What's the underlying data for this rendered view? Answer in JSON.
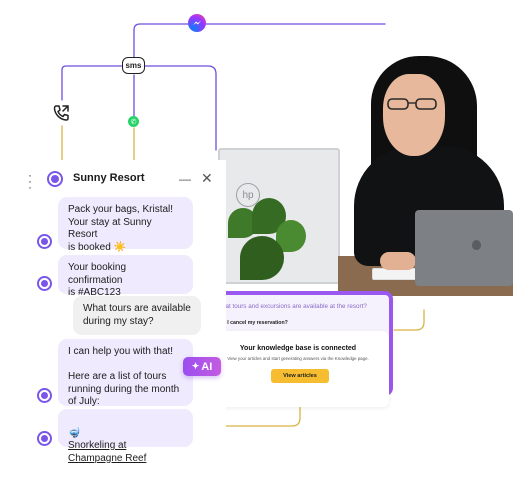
{
  "chat": {
    "brand_name": "Sunny Resort",
    "messages": [
      {
        "role": "bot",
        "text": "Pack your bags, Kristal!\nYour stay at Sunny Resort\nis booked ☀️"
      },
      {
        "role": "bot",
        "text": "Your booking confirmation\nis #ABC123"
      },
      {
        "role": "user",
        "text": "What tours are available\nduring my stay?"
      },
      {
        "role": "bot",
        "text": "I can help you with that!\n\nHere are a list of tours\nrunning during the month\nof July:"
      },
      {
        "role": "bot",
        "emoji": "🤿",
        "link_text": "Snorkeling at\nChampagne Reef"
      }
    ],
    "ai_badge": "AI"
  },
  "channels": {
    "sms_label": "sms"
  },
  "knowledge_base": {
    "question_1": "What tours and excursions are available at the resort?",
    "question_2": "Can I cancel my reservation?",
    "title": "Your knowledge base is connected",
    "subtitle": "View your articles and start generating answers via the Knowledge page.",
    "button_label": "View articles"
  },
  "icons": [
    "messenger-icon",
    "sms-icon",
    "whatsapp-icon",
    "phone-icon",
    "menu-icon",
    "minimize-icon",
    "close-icon",
    "sparkle-icon"
  ],
  "colors": {
    "accent_purple": "#7a56e8",
    "bot_bubble": "#efeafd",
    "user_bubble": "#f0f0f1",
    "kb_border": "#9b58f0",
    "button_yellow": "#f5bd2f",
    "line_purple": "#6f4fe0",
    "line_gold": "#d9b343"
  }
}
